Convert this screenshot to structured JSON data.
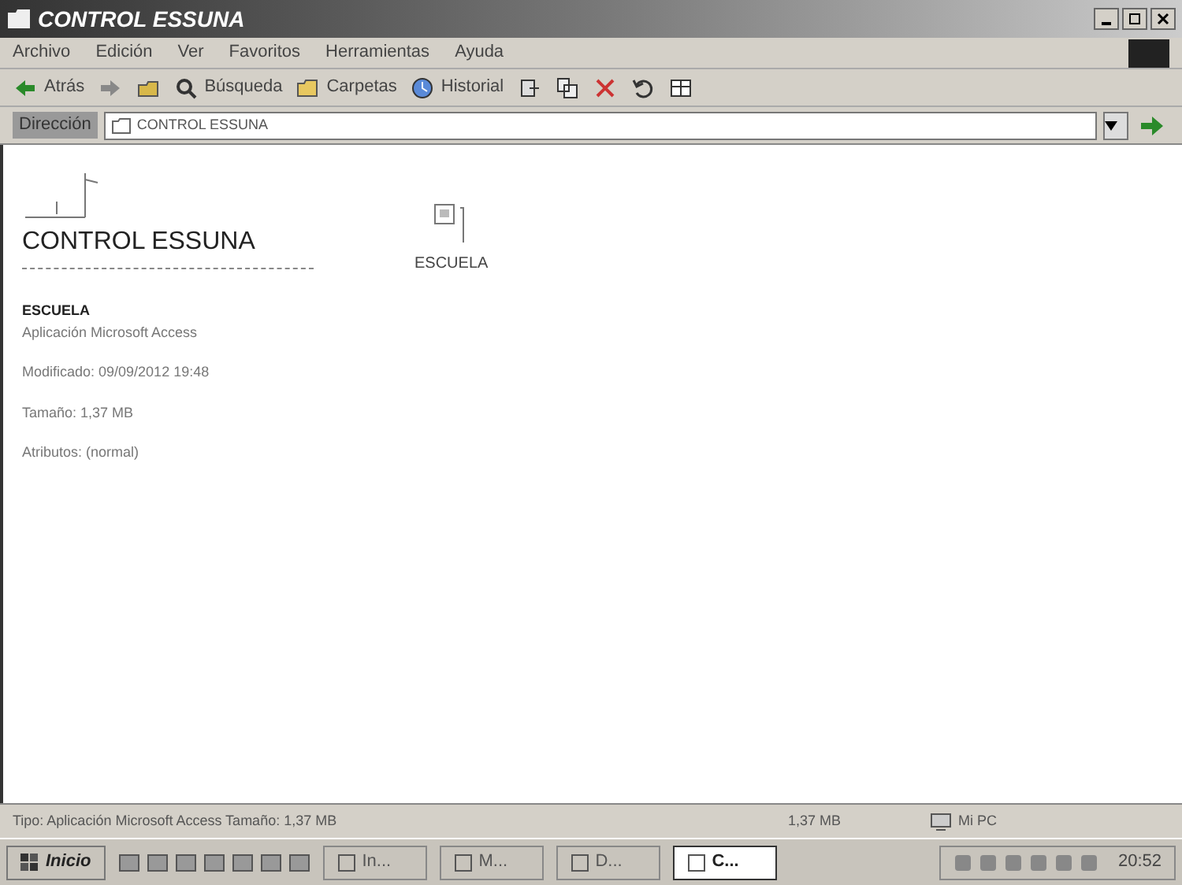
{
  "window": {
    "title": "CONTROL ESSUNA"
  },
  "menu": [
    "Archivo",
    "Edición",
    "Ver",
    "Favoritos",
    "Herramientas",
    "Ayuda"
  ],
  "toolbar": [
    {
      "kind": "back",
      "label": "Atrás"
    },
    {
      "kind": "forward"
    },
    {
      "kind": "up"
    },
    {
      "kind": "search",
      "label": "Búsqueda"
    },
    {
      "kind": "folders",
      "label": "Carpetas"
    },
    {
      "kind": "history",
      "label": "Historial"
    },
    {
      "kind": "move"
    },
    {
      "kind": "copy"
    },
    {
      "kind": "delete"
    },
    {
      "kind": "undo"
    },
    {
      "kind": "views"
    }
  ],
  "address": {
    "label": "Dirección",
    "value": "CONTROL ESSUNA"
  },
  "folder": {
    "title": "CONTROL ESSUNA",
    "details": {
      "name": "ESCUELA",
      "type": "Aplicación Microsoft Access",
      "modified": "Modificado: 09/09/2012 19:48",
      "size": "Tamaño: 1,37 MB",
      "attributes": "Atributos: (normal)"
    }
  },
  "files": [
    {
      "name": "ESCUELA",
      "selected": false
    }
  ],
  "status_bar": {
    "text": "Tipo: Aplicación Microsoft Access Tamaño: 1,37 MB",
    "size": "1,37 MB",
    "zone": "Mi PC"
  },
  "taskbar": {
    "start": "Inicio",
    "tasks": [
      {
        "label": "In...",
        "selected": false
      },
      {
        "label": "M...",
        "selected": false
      },
      {
        "label": "D...",
        "selected": false
      },
      {
        "label": "C...",
        "selected": true
      }
    ],
    "time": "20:52"
  }
}
